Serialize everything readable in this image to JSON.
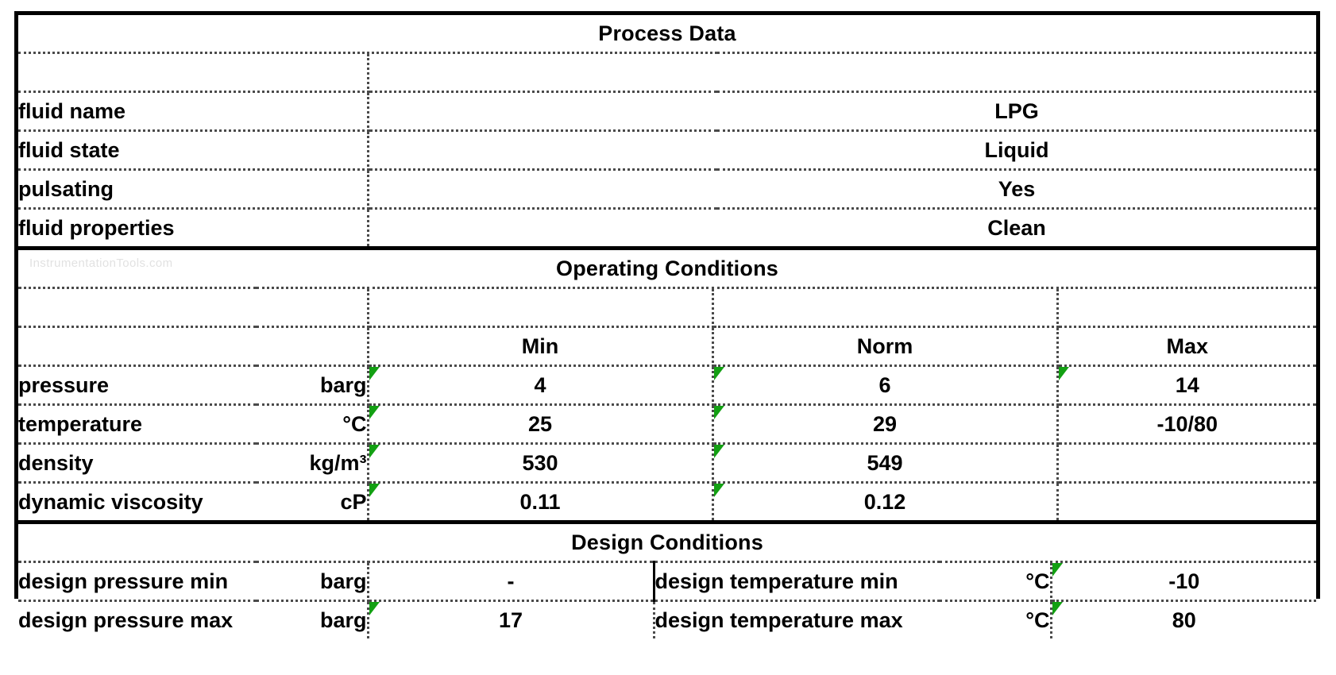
{
  "watermark": "InstrumentationTools.com",
  "sections": {
    "process_data": {
      "title": "Process Data",
      "rows": [
        {
          "label": "fluid name",
          "value": "LPG"
        },
        {
          "label": "fluid state",
          "value": "Liquid"
        },
        {
          "label": "pulsating",
          "value": "Yes"
        },
        {
          "label": "fluid properties",
          "value": "Clean"
        }
      ]
    },
    "operating_conditions": {
      "title": "Operating Conditions",
      "headers": {
        "min": "Min",
        "norm": "Norm",
        "max": "Max"
      },
      "rows": [
        {
          "label": "pressure",
          "unit": "barg",
          "min": "4",
          "norm": "6",
          "max": "14"
        },
        {
          "label": "temperature",
          "unit": "°C",
          "min": "25",
          "norm": "29",
          "max": "-10/80"
        },
        {
          "label": "density",
          "unit": "kg/m³",
          "min": "530",
          "norm": "549",
          "max": ""
        },
        {
          "label": "dynamic viscosity",
          "unit": "cP",
          "min": "0.11",
          "norm": "0.12",
          "max": ""
        }
      ]
    },
    "design_conditions": {
      "title": "Design Conditions",
      "rows": [
        {
          "left_label": "design pressure min",
          "left_unit": "barg",
          "left_value": "-",
          "right_label": "design temperature min",
          "right_unit": "°C",
          "right_value": "-10"
        },
        {
          "left_label": "design pressure max",
          "left_unit": "barg",
          "left_value": "17",
          "right_label": "design temperature max",
          "right_unit": "°C",
          "right_value": "80"
        }
      ]
    }
  },
  "colors": {
    "border": "#000000",
    "gridline": "#4a4a4a",
    "comment_marker": "#13a013",
    "watermark": "#e2e2e2",
    "text": "#000000",
    "background": "#ffffff"
  }
}
